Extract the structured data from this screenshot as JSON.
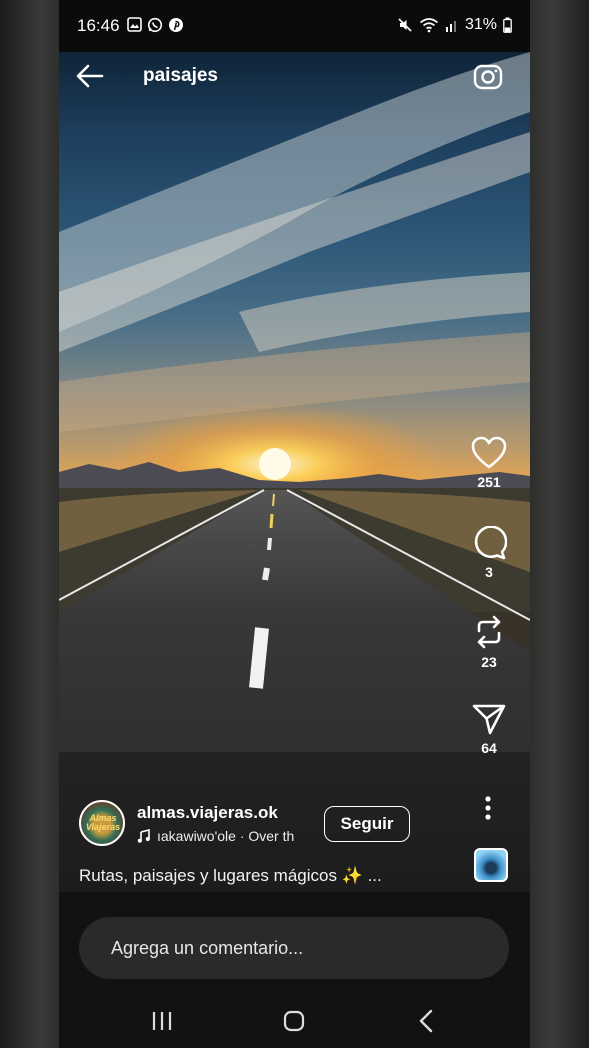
{
  "status_bar": {
    "time": "16:46",
    "battery": "31%",
    "icons_left": [
      "image-icon",
      "whatsapp-icon",
      "pinterest-icon"
    ],
    "icons_right": [
      "mute-icon",
      "wifi-icon",
      "signal-icon",
      "battery-icon"
    ]
  },
  "header": {
    "title": "paisajes"
  },
  "actions": {
    "likes": "251",
    "comments": "3",
    "reposts": "23",
    "shares": "64"
  },
  "post": {
    "avatar_text": "Almas Viajeras",
    "username": "almas.viajeras.ok",
    "music": "ıakawiwo'ole · Over th",
    "follow_label": "Seguir",
    "caption": "Rutas, paisajes y lugares mágicos ✨ ..."
  },
  "comment": {
    "placeholder": "Agrega un comentario..."
  },
  "colors": {
    "background": "#000000",
    "input_bg": "#2a2a2a",
    "text": "#ffffff"
  }
}
